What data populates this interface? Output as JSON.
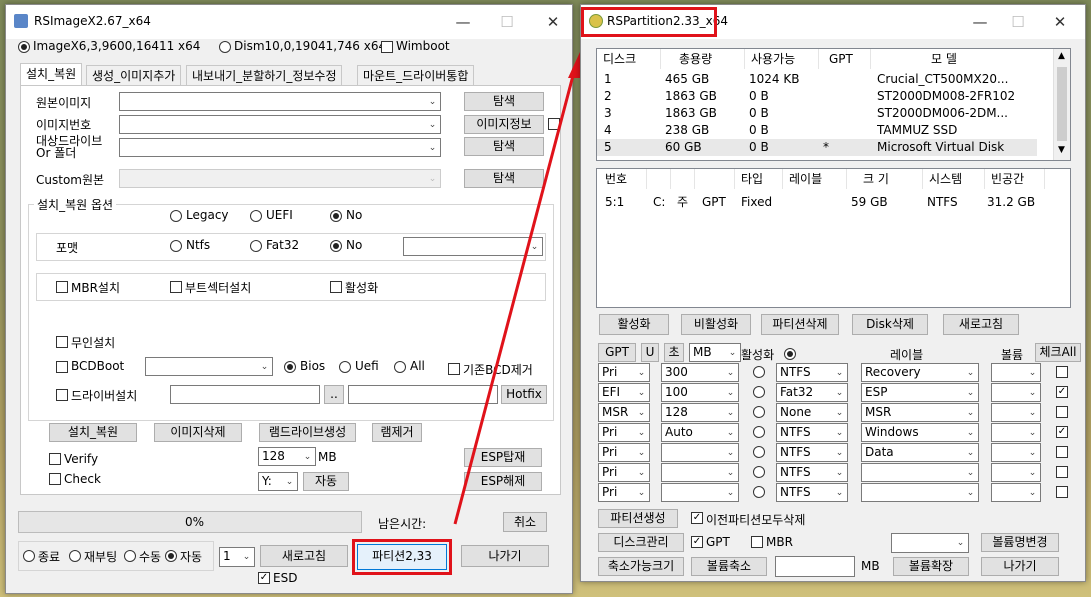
{
  "left_window": {
    "title": "RSImageX2.67_x64",
    "radio_image": "ImageX6,3,9600,16411 x64",
    "radio_dism": "Dism10,0,19041,746 x64",
    "wimboot_label": "Wimboot",
    "tabs": [
      "설치_복원",
      "생성_이미지추가",
      "내보내기_분할하기_정보수정",
      "마운트_드라이버통합"
    ],
    "source_image_label": "원본이미지",
    "image_number_label": "이미지번호",
    "target_drive_label": "대상드라이브",
    "target_folder_label": "Or 폴더",
    "custom_source_label": "Custom원본",
    "browse_label": "탐색",
    "image_info_label": "이미지정보",
    "options_group_label": "설치_복원 옵션",
    "opt_legacy": "Legacy",
    "opt_uefi": "UEFI",
    "opt_no": "No",
    "format_label": "포맷",
    "opt_ntfs": "Ntfs",
    "opt_fat32": "Fat32",
    "mbr_install": "MBR설치",
    "bootsector_install": "부트섹터설치",
    "activate": "활성화",
    "unattended": "무인설치",
    "bcdboot": "BCDBoot",
    "bios": "Bios",
    "uefi2": "Uefi",
    "all": "All",
    "remove_bcd": "기존BCD제거",
    "driver_install": "드라이버설치",
    "dotdot": "..",
    "hotfix": "Hotfix",
    "install_restore": "설치_복원",
    "delete_image": "이미지삭제",
    "ramdrive_create": "램드라이브생성",
    "ram_remove": "램제거",
    "verify": "Verify",
    "check": "Check",
    "ram_size": "128",
    "mb": "MB",
    "drive_letter": "Y:",
    "auto": "자동",
    "esp_mount": "ESP탑재",
    "esp_unmount": "ESP해제",
    "progress": "0%",
    "remaining": "남은시간:",
    "cancel": "취소",
    "end_shutdown": "종료",
    "reboot": "재부팅",
    "manual": "수동",
    "auto_radio": "자동",
    "count": "1",
    "refresh": "새로고침",
    "partition": "파티션2,33",
    "exit": "나가기",
    "esd": "ESD"
  },
  "right_window": {
    "title": "RSPartition2.33_x64",
    "disk_headers": [
      "디스크",
      "총용량",
      "사용가능",
      "GPT",
      "모    델"
    ],
    "disks": [
      {
        "n": "1",
        "total": "465 GB",
        "free": "1024 KB",
        "gpt": "",
        "model": "Crucial_CT500MX20..."
      },
      {
        "n": "2",
        "total": "1863 GB",
        "free": "0 B",
        "gpt": "",
        "model": "ST2000DM008-2FR102"
      },
      {
        "n": "3",
        "total": "1863 GB",
        "free": "0 B",
        "gpt": "",
        "model": "ST2000DM006-2DM..."
      },
      {
        "n": "4",
        "total": "238 GB",
        "free": "0 B",
        "gpt": "",
        "model": "TAMMUZ SSD"
      },
      {
        "n": "5",
        "total": "60 GB",
        "free": "0 B",
        "gpt": "*",
        "model": "Microsoft Virtual Disk"
      }
    ],
    "part_headers": [
      "번호",
      "",
      "",
      "",
      "타입",
      "레이블",
      "크 기",
      "시스템",
      "빈공간"
    ],
    "partitions": [
      {
        "num": "5:1",
        "drv": "C:",
        "main": "주",
        "gpt": "GPT",
        "type": "Fixed",
        "label": "",
        "size": "59 GB",
        "fs": "NTFS",
        "free": "31.2 GB"
      }
    ],
    "btn_activate": "활성화",
    "btn_deactivate": "비활성화",
    "btn_delete_part": "파티션삭제",
    "btn_disk_delete": "Disk삭제",
    "btn_refresh": "새로고침",
    "btn_gpt": "GPT",
    "btn_u": "U",
    "btn_init": "초",
    "unit": "MB",
    "activate_label": "활성화",
    "label_header": "레이블",
    "volume_header": "볼륨",
    "check_all": "체크All",
    "rows": [
      {
        "type": "Pri",
        "size": "300",
        "fs": "NTFS",
        "label": "Recovery",
        "checked": false
      },
      {
        "type": "EFI",
        "size": "100",
        "fs": "Fat32",
        "label": "ESP",
        "checked": true
      },
      {
        "type": "MSR",
        "size": "128",
        "fs": "None",
        "label": "MSR",
        "checked": false
      },
      {
        "type": "Pri",
        "size": "Auto",
        "fs": "NTFS",
        "label": "Windows",
        "checked": true
      },
      {
        "type": "Pri",
        "size": "",
        "fs": "NTFS",
        "label": "Data",
        "checked": false
      },
      {
        "type": "Pri",
        "size": "",
        "fs": "NTFS",
        "label": "",
        "checked": false
      },
      {
        "type": "Pri",
        "size": "",
        "fs": "NTFS",
        "label": "",
        "checked": false
      }
    ],
    "btn_create": "파티션생성",
    "delete_all_prev": "이전파티션모두삭제",
    "btn_disk_mgmt": "디스크관리",
    "gpt_chk": "GPT",
    "mbr_chk": "MBR",
    "btn_rename_vol": "볼륨명변경",
    "btn_shrinkable": "축소가능크기",
    "btn_shrink": "볼륨축소",
    "mb2": "MB",
    "btn_extend": "볼륨확장",
    "btn_exit": "나가기"
  }
}
